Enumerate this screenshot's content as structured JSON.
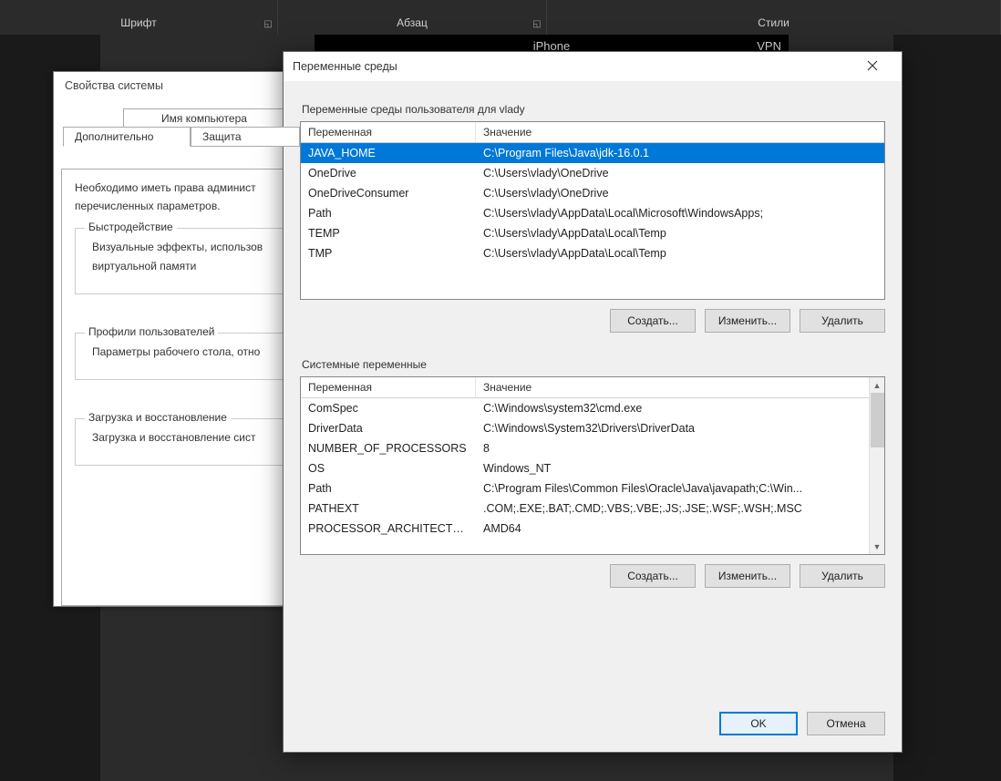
{
  "ribbon": {
    "group1": "Шрифт",
    "group2": "Абзац",
    "group3": "Стили"
  },
  "backbar": {
    "center": "iPhone",
    "right": "VPN"
  },
  "sysprops": {
    "title": "Свойства системы",
    "tab_computer_name": "Имя компьютера",
    "tab_advanced": "Дополнительно",
    "tab_protection": "Защита",
    "intro1": "Необходимо иметь права админист",
    "intro2": "перечисленных параметров.",
    "perf_legend": "Быстродействие",
    "perf_desc1": "Визуальные эффекты, использов",
    "perf_desc2": "виртуальной памяти",
    "profiles_legend": "Профили пользователей",
    "profiles_desc": "Параметры рабочего стола, отно",
    "startup_legend": "Загрузка и восстановление",
    "startup_desc": "Загрузка и восстановление сист"
  },
  "env": {
    "title": "Переменные среды",
    "user_section": "Переменные среды пользователя для vlady",
    "sys_section": "Системные переменные",
    "col_var": "Переменная",
    "col_val": "Значение",
    "btn_new": "Создать...",
    "btn_edit": "Изменить...",
    "btn_delete": "Удалить",
    "btn_ok": "OK",
    "btn_cancel": "Отмена",
    "user_vars": [
      {
        "name": "JAVA_HOME",
        "value": "C:\\Program Files\\Java\\jdk-16.0.1",
        "selected": true
      },
      {
        "name": "OneDrive",
        "value": "C:\\Users\\vlady\\OneDrive"
      },
      {
        "name": "OneDriveConsumer",
        "value": "C:\\Users\\vlady\\OneDrive"
      },
      {
        "name": "Path",
        "value": "C:\\Users\\vlady\\AppData\\Local\\Microsoft\\WindowsApps;"
      },
      {
        "name": "TEMP",
        "value": "C:\\Users\\vlady\\AppData\\Local\\Temp"
      },
      {
        "name": "TMP",
        "value": "C:\\Users\\vlady\\AppData\\Local\\Temp"
      }
    ],
    "sys_vars": [
      {
        "name": "ComSpec",
        "value": "C:\\Windows\\system32\\cmd.exe"
      },
      {
        "name": "DriverData",
        "value": "C:\\Windows\\System32\\Drivers\\DriverData"
      },
      {
        "name": "NUMBER_OF_PROCESSORS",
        "value": "8"
      },
      {
        "name": "OS",
        "value": "Windows_NT"
      },
      {
        "name": "Path",
        "value": "C:\\Program Files\\Common Files\\Oracle\\Java\\javapath;C:\\Win..."
      },
      {
        "name": "PATHEXT",
        "value": ".COM;.EXE;.BAT;.CMD;.VBS;.VBE;.JS;.JSE;.WSF;.WSH;.MSC"
      },
      {
        "name": "PROCESSOR_ARCHITECTU...",
        "value": "AMD64"
      }
    ]
  }
}
